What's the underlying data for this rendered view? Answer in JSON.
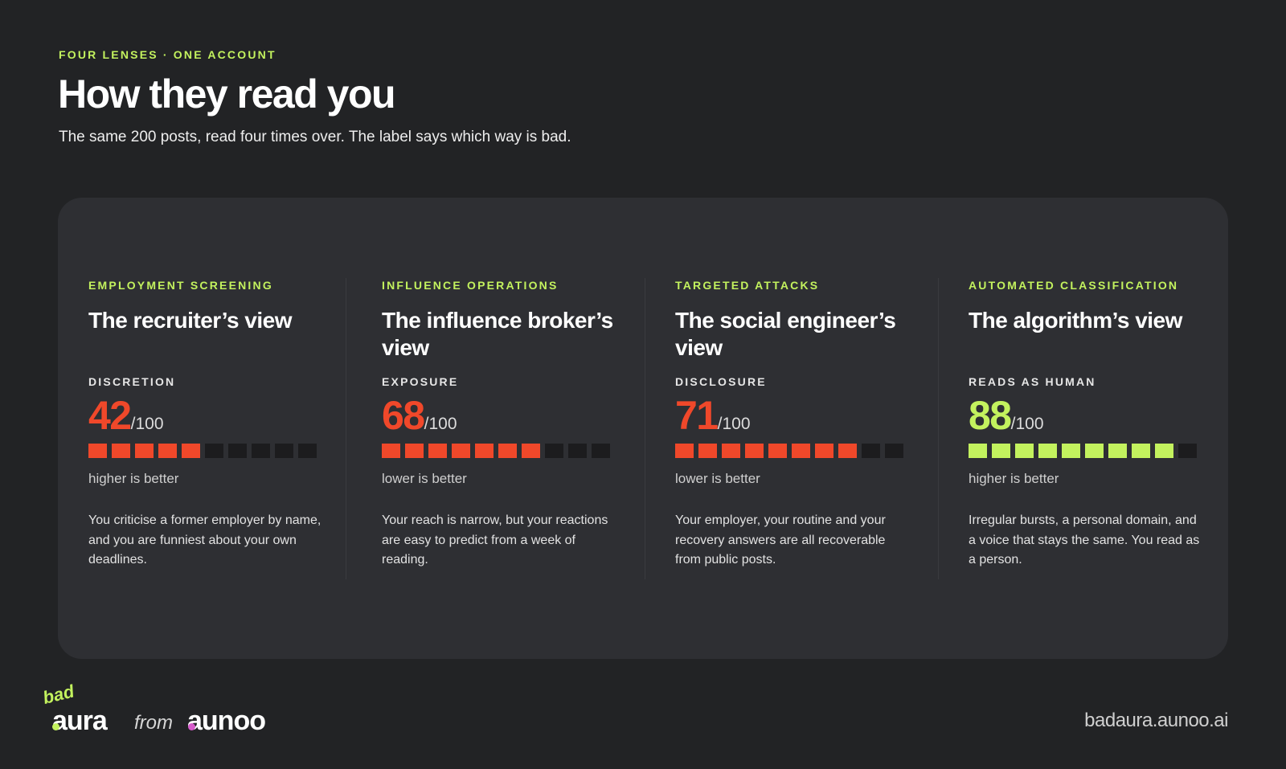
{
  "header": {
    "eyebrow": "FOUR LENSES · ONE ACCOUNT",
    "title": "How they read you",
    "subtitle": "The same 200 posts, read four times over. The label says which way is bad."
  },
  "lenses": [
    {
      "label": "EMPLOYMENT SCREENING",
      "title": "The recruiter’s view",
      "metric": "DISCRETION",
      "score": "42",
      "out_of": "/100",
      "filled_segments": 5,
      "total_segments": 10,
      "tone": "bad",
      "direction": "higher is better",
      "description": "You criticise a former employer by name, and you are funniest about your own deadlines."
    },
    {
      "label": "INFLUENCE OPERATIONS",
      "title": "The influence broker’s view",
      "metric": "EXPOSURE",
      "score": "68",
      "out_of": "/100",
      "filled_segments": 7,
      "total_segments": 10,
      "tone": "bad",
      "direction": "lower is better",
      "description": "Your reach is narrow, but your reactions are easy to predict from a week of reading."
    },
    {
      "label": "TARGETED ATTACKS",
      "title": "The social engineer’s view",
      "metric": "DISCLOSURE",
      "score": "71",
      "out_of": "/100",
      "filled_segments": 8,
      "total_segments": 10,
      "tone": "bad",
      "direction": "lower is better",
      "description": "Your employer, your routine and your recovery answers are all recoverable from public posts."
    },
    {
      "label": "AUTOMATED CLASSIFICATION",
      "title": "The algorithm’s view",
      "metric": "READS AS HUMAN",
      "score": "88",
      "out_of": "/100",
      "filled_segments": 9,
      "total_segments": 10,
      "tone": "good",
      "direction": "higher is better",
      "description": "Irregular bursts, a personal domain, and a voice that stays the same. You read as a person."
    }
  ],
  "colors": {
    "accent_green": "#c3f25e",
    "accent_red": "#f0482a",
    "background": "#222325",
    "panel": "#2e2f33"
  },
  "footer": {
    "brand_bad": "bad",
    "brand_aura": "aura",
    "brand_from": "from",
    "brand_aunoo": "aunoo",
    "url": "badaura.aunoo.ai"
  }
}
